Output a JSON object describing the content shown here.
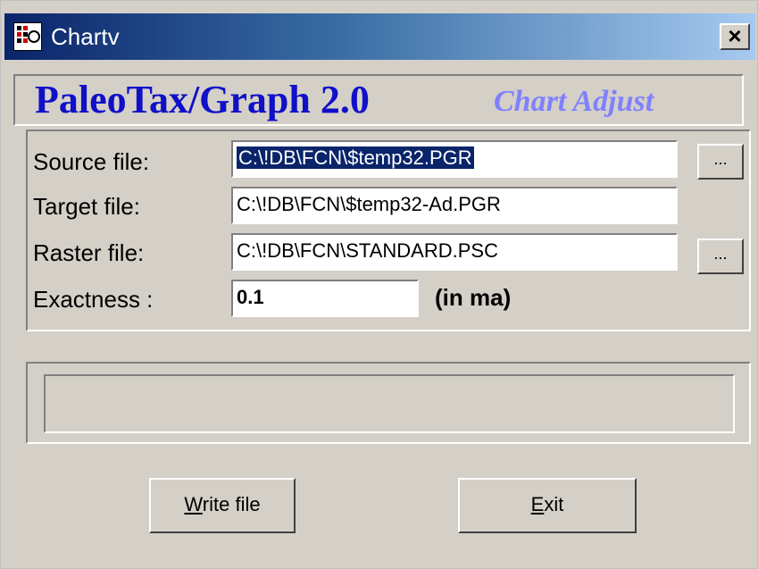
{
  "window": {
    "title": "Chartv",
    "close_label": "×"
  },
  "banner": {
    "title": "PaleoTax/Graph 2.0",
    "subtitle": "Chart Adjust"
  },
  "form": {
    "source": {
      "label": "Source file:",
      "value": "C:\\!DB\\FCN\\$temp32.PGR",
      "browse_label": "..."
    },
    "target": {
      "label": "Target file:",
      "value": "C:\\!DB\\FCN\\$temp32-Ad.PGR"
    },
    "raster": {
      "label": "Raster file:",
      "value": "C:\\!DB\\FCN\\STANDARD.PSC",
      "browse_label": "..."
    },
    "exactness": {
      "label": "Exactness :",
      "value": "0.1",
      "units": "(in ma)"
    }
  },
  "status": {
    "text": ""
  },
  "buttons": {
    "write": {
      "mnemonic": "W",
      "rest": "rite file"
    },
    "exit": {
      "mnemonic": "E",
      "rest": "xit"
    }
  },
  "colors": {
    "title_gradient_start": "#0a246a",
    "title_gradient_end": "#a6caf0",
    "banner_title": "#1010c8",
    "banner_subtitle": "#8080ff",
    "face": "#d4d0c8"
  }
}
